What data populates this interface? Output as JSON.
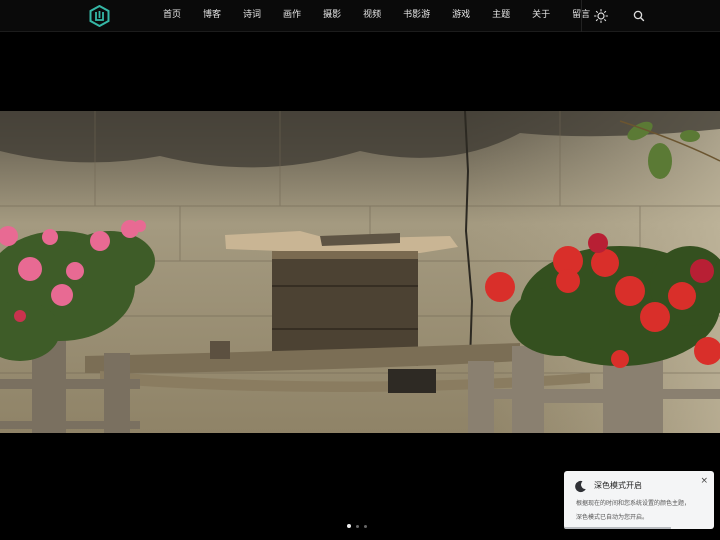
{
  "nav": {
    "logo_icon": "teal-hexagon-logo-icon",
    "accent_color": "#35b7a6",
    "items": [
      {
        "label": "首页"
      },
      {
        "label": "博客"
      },
      {
        "label": "诗词"
      },
      {
        "label": "画作"
      },
      {
        "label": "摄影"
      },
      {
        "label": "视频"
      },
      {
        "label": "书影游"
      },
      {
        "label": "游戏"
      },
      {
        "label": "主题"
      },
      {
        "label": "关于"
      },
      {
        "label": "留言"
      }
    ],
    "theme_icon": "sun-icon",
    "search_icon": "search-icon"
  },
  "hero": {
    "image": "wooden-box-with-roses-photo",
    "slide_count": 3,
    "active_slide": 1
  },
  "toast": {
    "icon": "moon-icon",
    "title": "深色模式开启",
    "close_label": "×",
    "message_line1": "根据现在的时间和您系统设置的颜色主题，",
    "message_line2": "深色模式已自动为您开启。",
    "progress": 0.71
  }
}
